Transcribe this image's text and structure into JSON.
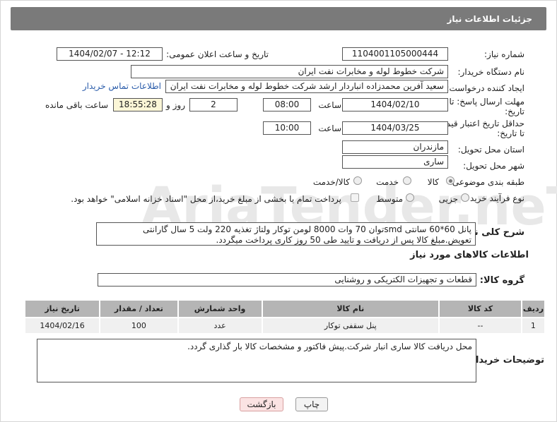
{
  "header": {
    "title": "جزئیات اطلاعات نیاز"
  },
  "watermark": "AriaTender.neT",
  "fields": {
    "need_number_label": "شماره نیاز:",
    "need_number": "1104001105000444",
    "announce_label": "تاریخ و ساعت اعلان عمومی:",
    "announce_value": "1404/02/07 - 12:12",
    "buyer_org_label": "نام دستگاه خریدار:",
    "buyer_org": "شرکت خطوط لوله و مخابرات نفت ایران",
    "requester_label": "ایجاد کننده درخواست:",
    "requester": "سعید آفرین محمدزاده انباردار ارشد شرکت خطوط لوله و مخابرات نفت ایران",
    "contact_link": "اطلاعات تماس خریدار",
    "deadline_label_1": "مهلت ارسال پاسخ: تا",
    "deadline_label_2": "تاریخ:",
    "deadline_date": "1404/02/10",
    "time_label": "ساعت",
    "deadline_time": "08:00",
    "days_value": "2",
    "days_label": "روز و",
    "remaining_time": "18:55:28",
    "remaining_label": "ساعت باقی مانده",
    "min_price_label_1": "حداقل تاریخ اعتبار قیمت:",
    "min_price_label_2": "تا تاریخ:",
    "price_date": "1404/03/25",
    "price_time": "10:00",
    "province_label": "استان محل تحویل:",
    "province": "مازندران",
    "city_label": "شهر محل تحویل:",
    "city": "ساری",
    "category_label": "طبقه بندی موضوعی:",
    "category_options": [
      "کالا",
      "خدمت",
      "کالا/خدمت"
    ],
    "process_label": "نوع فرآیند خرید :",
    "process_options": [
      "جزیی",
      "متوسط"
    ],
    "payment_note": "پرداخت تمام یا بخشی از مبلغ خرید،از محل \"اسناد خزانه اسلامی\" خواهد بود.",
    "description_label": "شرح کلی نیاز:",
    "description": "پانل 60*60 سانتی smdتوان 70 وات 8000 لومن توکار ولتاژ تغذیه 220 ولت 5 سال گارانتی تعویض.مبلغ کالا پس از دریافت و تایید طی 50 روز کاری پرداخت میگردد.",
    "goods_info_title": "اطلاعات کالاهای مورد نیاز",
    "goods_group_label": "گروه کالا:",
    "goods_group": "قطعات و تجهیزات الکتریکی و روشنایی",
    "buyer_notes_label": "توضیحات خریدار:",
    "buyer_notes": "محل دریافت کالا ساری انبار شرکت.پیش فاکتور و مشخصات کالا بار گذاری گردد."
  },
  "table": {
    "headers": [
      "ردیف",
      "کد کالا",
      "نام کالا",
      "واحد شمارش",
      "تعداد / مقدار",
      "تاریخ نیاز"
    ],
    "rows": [
      [
        "1",
        "--",
        "پنل سقفی توکار",
        "عدد",
        "100",
        "1404/02/16"
      ]
    ]
  },
  "buttons": {
    "print": "چاپ",
    "back": "بازگشت"
  }
}
